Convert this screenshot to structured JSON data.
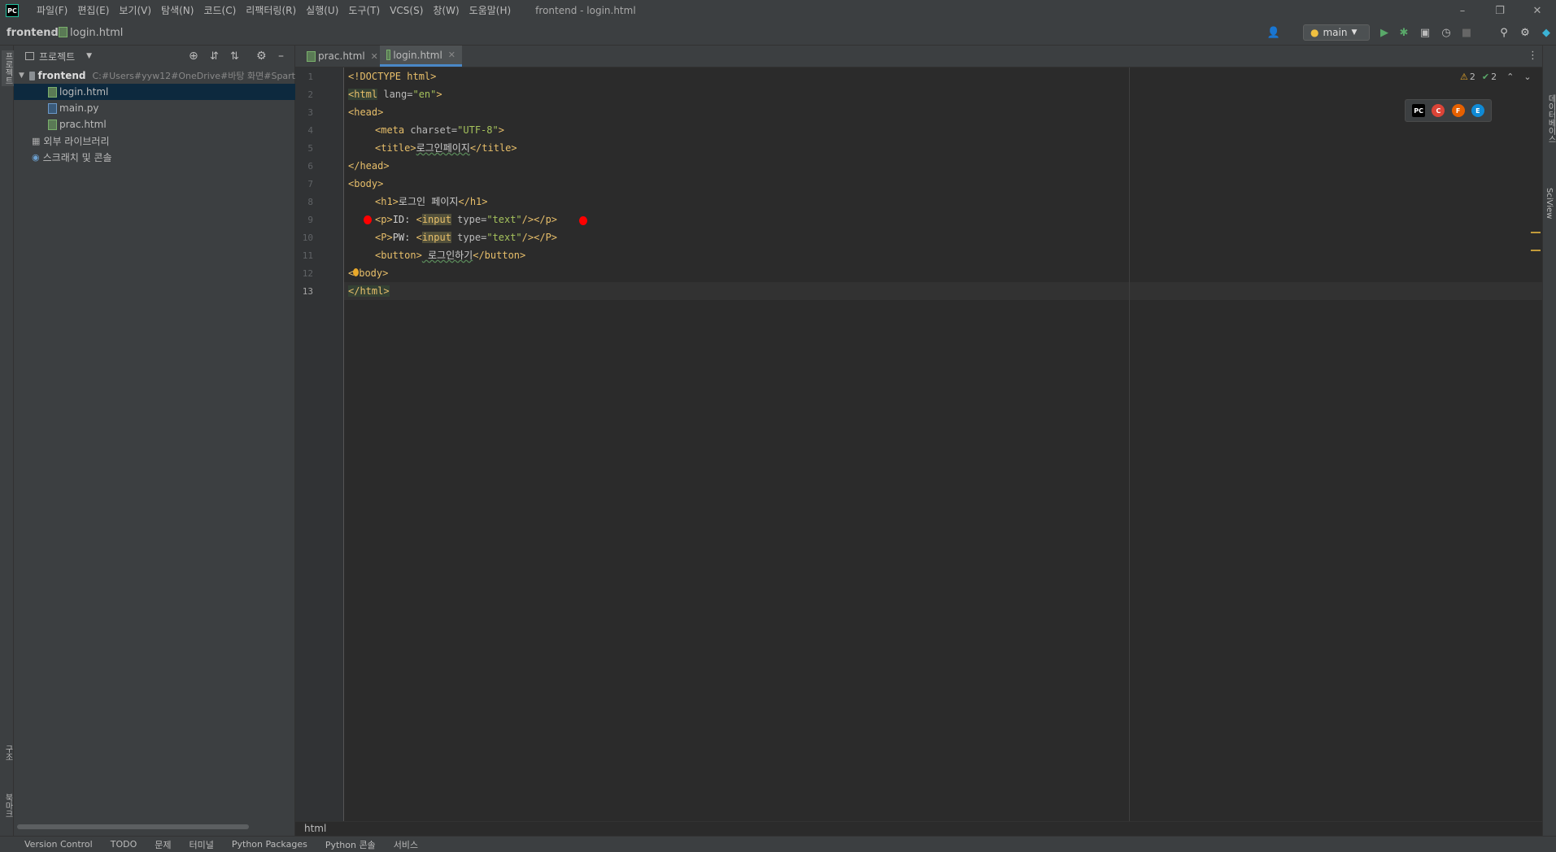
{
  "app": {
    "logo": "PC",
    "window_title": "frontend - login.html"
  },
  "menu": [
    "파일(F)",
    "편집(E)",
    "보기(V)",
    "탐색(N)",
    "코드(C)",
    "리팩터링(R)",
    "실행(U)",
    "도구(T)",
    "VCS(S)",
    "창(W)",
    "도움말(H)"
  ],
  "navbar": {
    "project": "frontend",
    "file": "login.html",
    "branch": "main"
  },
  "left_stripe": {
    "project_label": "프로젝트",
    "structure_label": "구조",
    "bookmarks_label": "북마크"
  },
  "project_panel": {
    "title": "프로젝트",
    "root": {
      "name": "frontend",
      "path": "C:#Users#yyw12#OneDrive#바탕 화면#Spart"
    },
    "files": [
      "login.html",
      "main.py",
      "prac.html"
    ],
    "external_libs": "외부 라이브러리",
    "scratches": "스크래치 및 콘솔"
  },
  "tabs": [
    {
      "label": "prac.html",
      "active": false
    },
    {
      "label": "login.html",
      "active": true
    }
  ],
  "inspections": {
    "warnings": "2",
    "ok": "2"
  },
  "browsers": [
    "PC",
    "C",
    "F",
    "E"
  ],
  "lines": [
    "1",
    "2",
    "3",
    "4",
    "5",
    "6",
    "7",
    "8",
    "9",
    "10",
    "11",
    "12",
    "13"
  ],
  "code": {
    "l1": "<!DOCTYPE html>",
    "l2_tag": "<html",
    "l2_attr": " lang=",
    "l2_val": "\"en\"",
    "l2_end": ">",
    "l3": "<head>",
    "l4_tag": "<meta",
    "l4_attr": " charset=",
    "l4_val": "\"UTF-8\"",
    "l4_end": ">",
    "l5_open": "<title>",
    "l5_text": "로그인페이지",
    "l5_close": "</title>",
    "l6": "</head>",
    "l7": "<body>",
    "l8_open": "<h1>",
    "l8_text": "로그인 페이지",
    "l8_close": "</h1>",
    "l9_open": "<p>",
    "l9_text": "ID: ",
    "l9_tag": "<",
    "l9_input": "input",
    "l9_attr": " type=",
    "l9_val": "\"text\"",
    "l9_end": "/></p>",
    "l10_open": "<P>",
    "l10_text": "PW: ",
    "l10_tag": "<",
    "l10_input": "input",
    "l10_attr": " type=",
    "l10_val": "\"text\"",
    "l10_end": "/></P>",
    "l11_open": "<button>",
    "l11_text": " 로그인하기",
    "l11_close": "</button>",
    "l12_a": "<",
    "l12_b": "body>",
    "l13": "</html>"
  },
  "editor_breadcrumb": "html",
  "right_stripe": [
    "데이터베이스",
    "SciView"
  ],
  "bottom_tools": [
    "Version Control",
    "TODO",
    "문제",
    "터미널",
    "Python Packages",
    "Python 콘솔",
    "서비스"
  ],
  "colors": {
    "tag": "#e8bf6a",
    "string": "#a5c25c",
    "text": "#a9b7c6",
    "selection": "#0d293e",
    "accent": "#4a88c7"
  }
}
